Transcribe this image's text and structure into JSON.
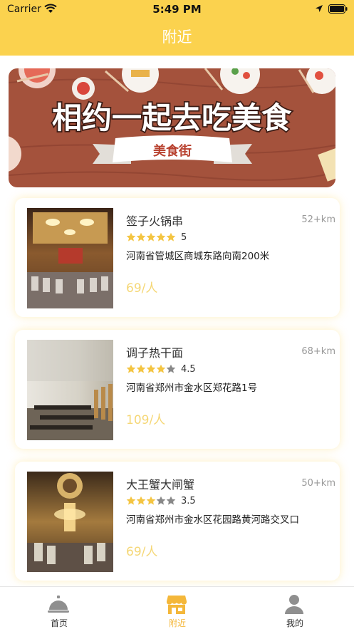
{
  "status_bar": {
    "carrier": "Carrier",
    "time": "5:49 PM"
  },
  "header": {
    "title": "附近"
  },
  "banner": {
    "headline": "相约一起去吃美食",
    "ribbon": "美食街"
  },
  "restaurants": [
    {
      "name": "签子火锅串",
      "distance": "52+km",
      "rating": 5,
      "rating_text": "5",
      "address": "河南省管城区商城东路向南200米",
      "price": "69/人"
    },
    {
      "name": "调子热干面",
      "distance": "68+km",
      "rating": 4.5,
      "rating_text": "4.5",
      "address": "河南省郑州市金水区郑花路1号",
      "price": "109/人"
    },
    {
      "name": "大王蟹大闸蟹",
      "distance": "50+km",
      "rating": 3.5,
      "rating_text": "3.5",
      "address": "河南省郑州市金水区花园路黄河路交叉口",
      "price": "69/人"
    }
  ],
  "tabbar": {
    "items": [
      {
        "label": "首页",
        "icon": "cloche-icon"
      },
      {
        "label": "附近",
        "icon": "shop-icon"
      },
      {
        "label": "我的",
        "icon": "user-icon"
      }
    ],
    "active": 1
  },
  "colors": {
    "brand": "#fbd24e",
    "star": "#f4c542",
    "price": "#f5d776",
    "active_tab": "#f4b73a"
  }
}
